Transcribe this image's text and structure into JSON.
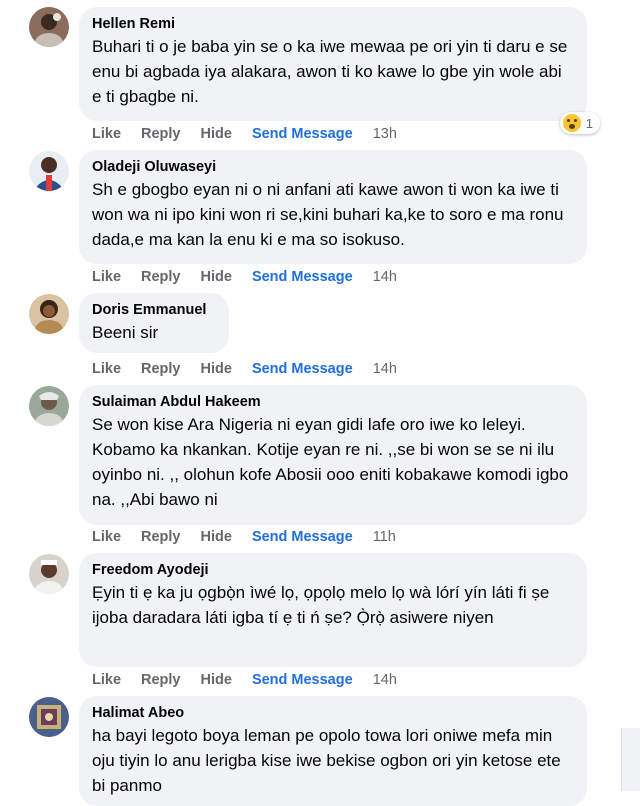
{
  "comments": [
    {
      "author": "Hellen Remi",
      "text": "Buhari ti o je baba yin se o ka iwe mewaa pe ori yin ti daru e se enu bi agbada iya alakara, awon ti ko kawe lo gbe yin wole abi e ti gbagbe ni.",
      "like": "Like",
      "reply": "Reply",
      "hide": "Hide",
      "send": "Send Message",
      "time": "13h",
      "reaction_count": "1",
      "avatar_color": "#8a6b5c"
    },
    {
      "author": "Oladeji Oluwaseyi",
      "text": "Sh e gbogbo eyan ni o ni anfani ati kawe awon ti won ka iwe ti won wa ni ipo kini won ri se,kini buhari ka,ke to soro e ma ronu dada,e ma kan la enu ki e ma so isokuso.",
      "like": "Like",
      "reply": "Reply",
      "hide": "Hide",
      "send": "Send Message",
      "time": "14h",
      "avatar_color": "#2b4f86"
    },
    {
      "author": "Doris Emmanuel",
      "text": "Beeni sir",
      "like": "Like",
      "reply": "Reply",
      "hide": "Hide",
      "send": "Send Message",
      "time": "14h",
      "avatar_color": "#c9a36b"
    },
    {
      "author": "Sulaiman Abdul Hakeem",
      "text": "Se won kise Ara Nigeria ni eyan gidi lafe oro iwe ko leleyi. Kobamo ka nkankan. Kotije eyan re ni. ,,se bi won se se ni ilu oyinbo ni. ,, olohun kofe Abosii ooo eniti kobakawe komodi igbo na. ,,Abi bawo ni",
      "like": "Like",
      "reply": "Reply",
      "hide": "Hide",
      "send": "Send Message",
      "time": "11h",
      "avatar_color": "#9aa89a"
    },
    {
      "author": "Freedom Ayodeji",
      "text": "Ẹyin ti ẹ ka ju ọgbọ̀n ìwé lọ, ọpọlọ melo lọ wà lórí yín láti fi ṣe ijoba daradara láti igba tí ẹ ti ń ṣe? Ọ̀rọ̀ asiwere niyen",
      "like": "Like",
      "reply": "Reply",
      "hide": "Hide",
      "send": "Send Message",
      "time": "14h",
      "avatar_color": "#d8d2cc"
    },
    {
      "author": "Halimat Abeo",
      "text": "ha bayi legoto boya leman pe opolo towa lori oniwe mefa min oju tiyin lo anu lerigba kise iwe bekise ogbon ori yin ketose ete bi panmo",
      "avatar_color": "#4a5f8a"
    }
  ]
}
